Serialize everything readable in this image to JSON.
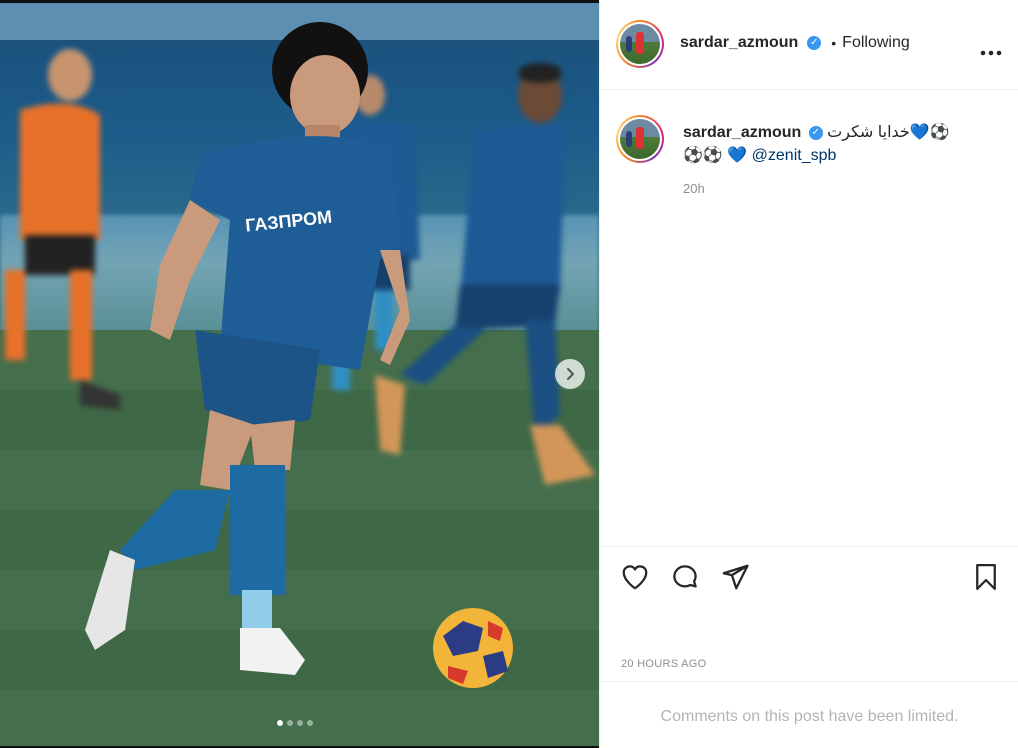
{
  "header": {
    "username": "sardar_azmoun",
    "separator": "•",
    "follow_label": "Following",
    "more_icon": "more-horizontal-icon"
  },
  "caption": {
    "username": "sardar_azmoun",
    "text_line1": "خدایا شکرت💙⚽",
    "text_line2_prefix": "⚽⚽ 💙 ",
    "mention": "@zenit_spb",
    "time": "20h"
  },
  "media": {
    "description_icon": "photo-carousel",
    "carousel_slides": 4,
    "active_slide": 1
  },
  "actions": {
    "like_icon": "heart-icon",
    "comment_icon": "comment-icon",
    "share_icon": "share-icon",
    "save_icon": "bookmark-icon"
  },
  "timestamp": "20 HOURS AGO",
  "comments_notice": "Comments on this post have been limited.",
  "colors": {
    "verified": "#3897f0",
    "mention": "#00376b",
    "muted": "#8e8e8e"
  }
}
